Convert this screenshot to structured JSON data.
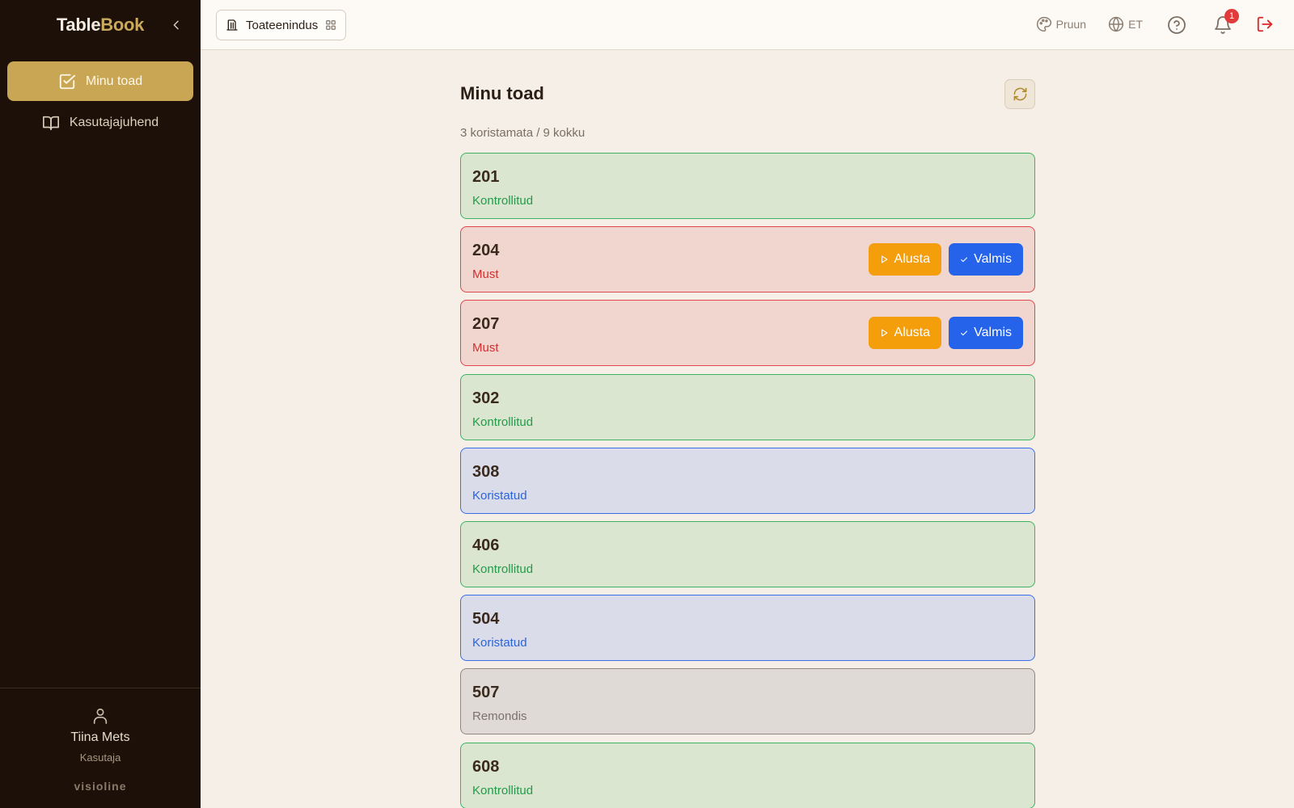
{
  "app": {
    "brand_part1": "Table",
    "brand_part2": "Book"
  },
  "sidebar": {
    "items": [
      {
        "label": "Minu toad",
        "icon": "checkbox-icon",
        "active": true
      },
      {
        "label": "Kasutajajuhend",
        "icon": "book-icon",
        "active": false
      }
    ],
    "user": {
      "name": "Tiina Mets",
      "role": "Kasutaja"
    },
    "vendor": "visioline"
  },
  "topbar": {
    "module_label": "Toateenindus",
    "theme_label": "Pruun",
    "lang_label": "ET",
    "notification_count": "1"
  },
  "main": {
    "title": "Minu toad",
    "summary": "3 koristamata / 9 kokku",
    "start_label": "Alusta",
    "done_label": "Valmis",
    "rooms": [
      {
        "number": "201",
        "status": "Kontrollitud",
        "state": "green",
        "actions": false
      },
      {
        "number": "204",
        "status": "Must",
        "state": "red",
        "actions": true
      },
      {
        "number": "207",
        "status": "Must",
        "state": "red",
        "actions": true
      },
      {
        "number": "302",
        "status": "Kontrollitud",
        "state": "green",
        "actions": false
      },
      {
        "number": "308",
        "status": "Koristatud",
        "state": "blue",
        "actions": false
      },
      {
        "number": "406",
        "status": "Kontrollitud",
        "state": "green",
        "actions": false
      },
      {
        "number": "504",
        "status": "Koristatud",
        "state": "blue",
        "actions": false
      },
      {
        "number": "507",
        "status": "Remondis",
        "state": "grey",
        "actions": false
      },
      {
        "number": "608",
        "status": "Kontrollitud",
        "state": "green",
        "actions": false
      }
    ]
  },
  "colors": {
    "sidebar_bg": "#1c1008",
    "accent_gold": "#c9a653",
    "start_orange": "#f59e0b",
    "done_blue": "#2563eb"
  }
}
